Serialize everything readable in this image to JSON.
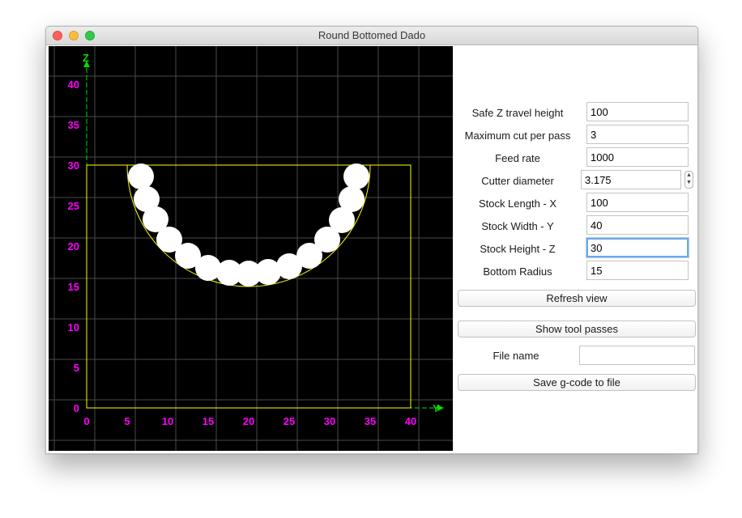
{
  "window": {
    "title": "Round Bottomed Dado"
  },
  "plot": {
    "axis_labels": {
      "z": "Z",
      "y": "Y"
    },
    "y_ticks": [
      "0",
      "5",
      "10",
      "15",
      "20",
      "25",
      "30",
      "35",
      "40"
    ],
    "z_ticks": [
      "0",
      "5",
      "10",
      "15",
      "20",
      "25",
      "30",
      "35",
      "40"
    ],
    "colors": {
      "background": "#000000",
      "grid": "#4a4a4a",
      "ticks": "#ff00ff",
      "axes": "#00dd00",
      "stock": "#ffff00",
      "tool": "#ffffff"
    },
    "stock": {
      "length_y": 40,
      "height_z": 30,
      "bottom_radius": 15
    },
    "tool_positions": [
      [
        6.7,
        28.6
      ],
      [
        7.4,
        25.8
      ],
      [
        8.5,
        23.3
      ],
      [
        10.2,
        20.8
      ],
      [
        12.5,
        18.8
      ],
      [
        15.0,
        17.3
      ],
      [
        17.6,
        16.7
      ],
      [
        20.0,
        16.6
      ],
      [
        22.4,
        16.8
      ],
      [
        25.0,
        17.5
      ],
      [
        27.5,
        18.8
      ],
      [
        29.7,
        20.8
      ],
      [
        31.5,
        23.2
      ],
      [
        32.7,
        25.8
      ],
      [
        33.3,
        28.6
      ]
    ]
  },
  "form": {
    "safe_z": {
      "label": "Safe Z travel height",
      "value": "100"
    },
    "max_cut": {
      "label": "Maximum cut per pass",
      "value": "3"
    },
    "feed_rate": {
      "label": "Feed rate",
      "value": "1000"
    },
    "cutter_diameter": {
      "label": "Cutter diameter",
      "value": "3.175"
    },
    "stock_length": {
      "label": "Stock Length - X",
      "value": "100"
    },
    "stock_width": {
      "label": "Stock Width - Y",
      "value": "40"
    },
    "stock_height": {
      "label": "Stock Height - Z",
      "value": "30"
    },
    "bottom_radius": {
      "label": "Bottom Radius",
      "value": "15"
    },
    "file_name": {
      "label": "File name",
      "value": ""
    }
  },
  "buttons": {
    "refresh": "Refresh view",
    "show_passes": "Show tool passes",
    "save": "Save g-code to file"
  }
}
